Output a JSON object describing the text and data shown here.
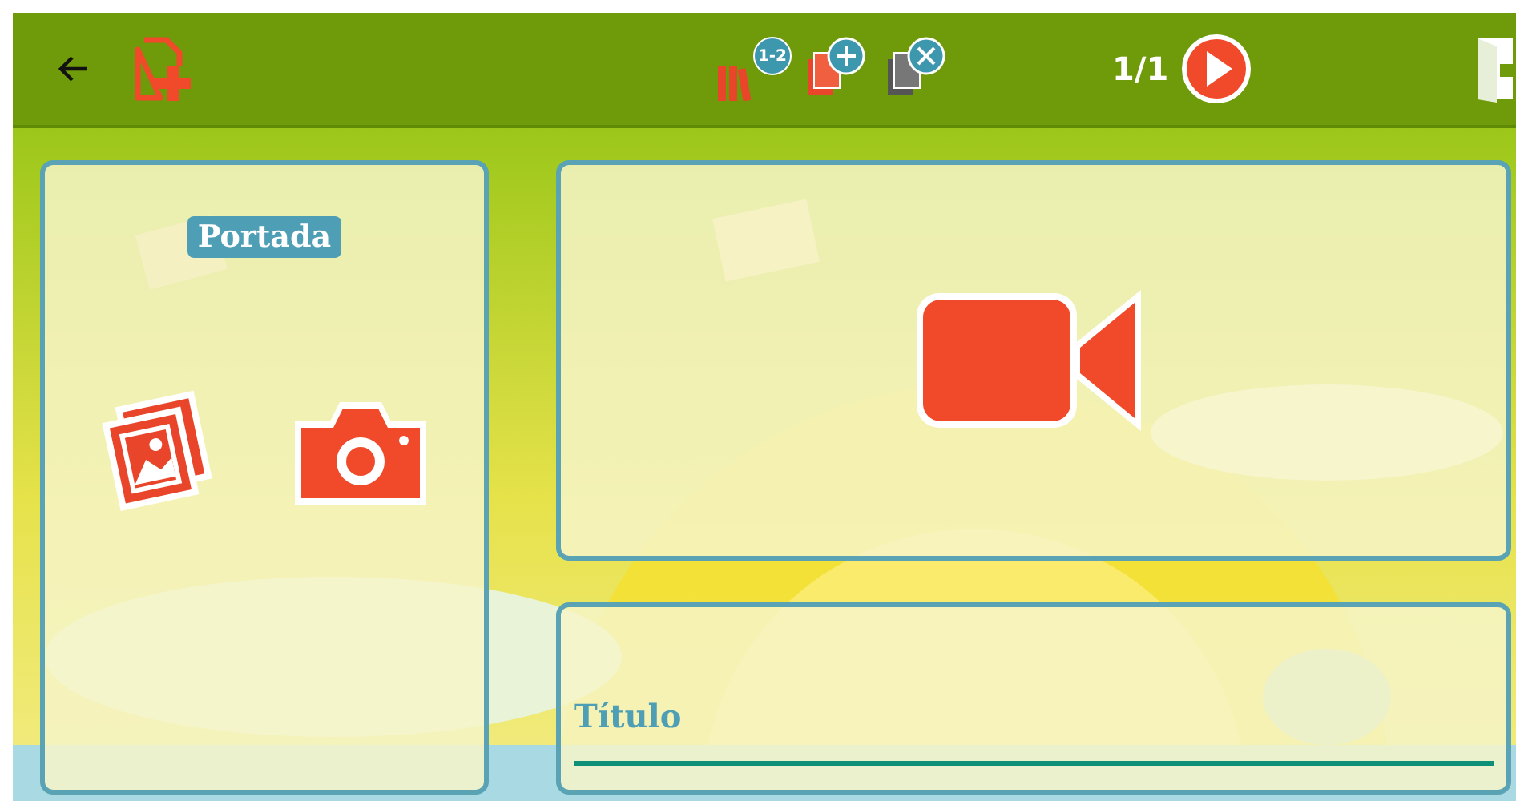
{
  "toolbar": {
    "badge_label": "1-2",
    "page_counter": "1/1"
  },
  "cover_panel": {
    "label": "Portada"
  },
  "title_field": {
    "placeholder": "Título"
  }
}
